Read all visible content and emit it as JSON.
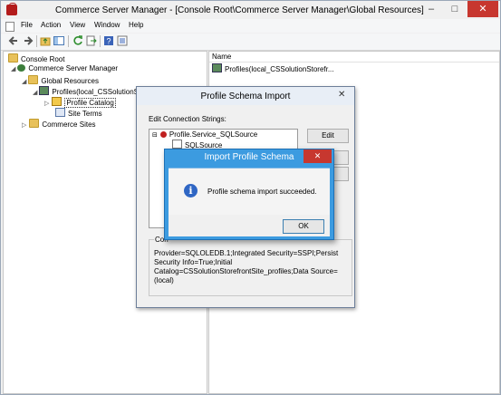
{
  "window": {
    "title": "Commerce Server Manager - [Console Root\\Commerce Server Manager\\Global Resources]"
  },
  "titlebar_buttons": {
    "minimize": "–",
    "maximize": "□",
    "close": "✕"
  },
  "menu": [
    "File",
    "Action",
    "View",
    "Window",
    "Help"
  ],
  "toolbar": {
    "icons": [
      "back-arrow-icon",
      "forward-arrow-icon",
      "up-folder-icon",
      "show-hide-tree-icon",
      "refresh-icon",
      "export-list-icon",
      "help-icon",
      "properties-icon"
    ]
  },
  "tree": {
    "console_root": "Console Root",
    "csm": "Commerce Server Manager",
    "global_resources": "Global Resources",
    "profiles": "Profiles(local_CSSolutionStorefrontSite_profiles)",
    "profile_catalog": "Profile Catalog",
    "site_terms": "Site Terms",
    "commerce_sites": "Commerce Sites"
  },
  "list": {
    "column_name": "Name",
    "item": "Profiles(local_CSSolutionStorefr..."
  },
  "schema_dialog": {
    "title": "Profile Schema Import",
    "edit_label": "Edit Connection Strings:",
    "tree_item1": "Profile.Service_SQLSource",
    "tree_item2": "SQLSource",
    "edit_button": "Edit",
    "conn_group_label": "Con",
    "conn_string": "Provider=SQLOLEDB.1;Integrated Security=SSPI;Persist Security Info=True;Initial Catalog=CSSolutionStorefrontSite_profiles;Data Source=(local)"
  },
  "import_dialog": {
    "title": "Import Profile Schema",
    "close": "✕",
    "message": "Profile schema import succeeded.",
    "ok": "OK"
  }
}
